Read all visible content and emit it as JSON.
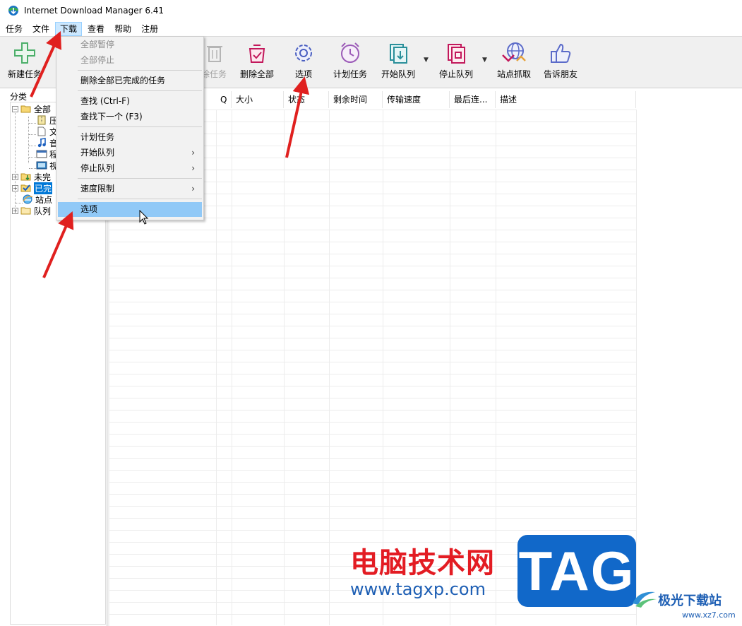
{
  "window": {
    "title": "Internet Download Manager 6.41"
  },
  "menubar": [
    "任务",
    "文件",
    "下载",
    "查看",
    "帮助",
    "注册"
  ],
  "menubar_active": "下载",
  "toolbar": {
    "new_task": "新建任务",
    "delete_task": "删除任务",
    "delete_all": "删除全部",
    "options": "选项",
    "schedule": "计划任务",
    "start_queue": "开始队列",
    "stop_queue": "停止队列",
    "site_grabber": "站点抓取",
    "tell_friend": "告诉朋友"
  },
  "sidebar": {
    "header": "分类",
    "items": [
      {
        "label": "全部",
        "expanded": true
      },
      {
        "label": "压",
        "child": true
      },
      {
        "label": "文",
        "child": true
      },
      {
        "label": "音",
        "child": true
      },
      {
        "label": "程",
        "child": true
      },
      {
        "label": "视",
        "child": true
      },
      {
        "label": "未完",
        "expanded": false
      },
      {
        "label": "已完",
        "expanded": false,
        "selected": true
      },
      {
        "label": "站点"
      },
      {
        "label": "队列",
        "expanded": false
      }
    ]
  },
  "table": {
    "columns": [
      "Q",
      "大小",
      "状态",
      "剩余时间",
      "传输速度",
      "最后连...",
      "描述"
    ]
  },
  "dropdown": {
    "items": [
      {
        "label": "全部暂停",
        "disabled": true
      },
      {
        "label": "全部停止",
        "disabled": true
      },
      {
        "label": "删除全部已完成的任务"
      },
      {
        "label": "查找 (Ctrl-F)"
      },
      {
        "label": "查找下一个 (F3)"
      },
      {
        "label": "计划任务"
      },
      {
        "label": "开始队列",
        "submenu": true
      },
      {
        "label": "停止队列",
        "submenu": true
      },
      {
        "label": "速度限制",
        "submenu": true
      },
      {
        "label": "选项",
        "highlighted": true
      }
    ],
    "submenu_glyph": "›"
  },
  "watermark": {
    "site_cn": "电脑技术网",
    "site_url": "www.tagxp.com",
    "tag": "TAG",
    "brand": "极光下载站",
    "brand_url": "www.xz7.com"
  },
  "colors": {
    "accent_selection": "#0078d7",
    "menu_highlight": "#91c9f7",
    "annotation_arrow": "#e0201f"
  }
}
